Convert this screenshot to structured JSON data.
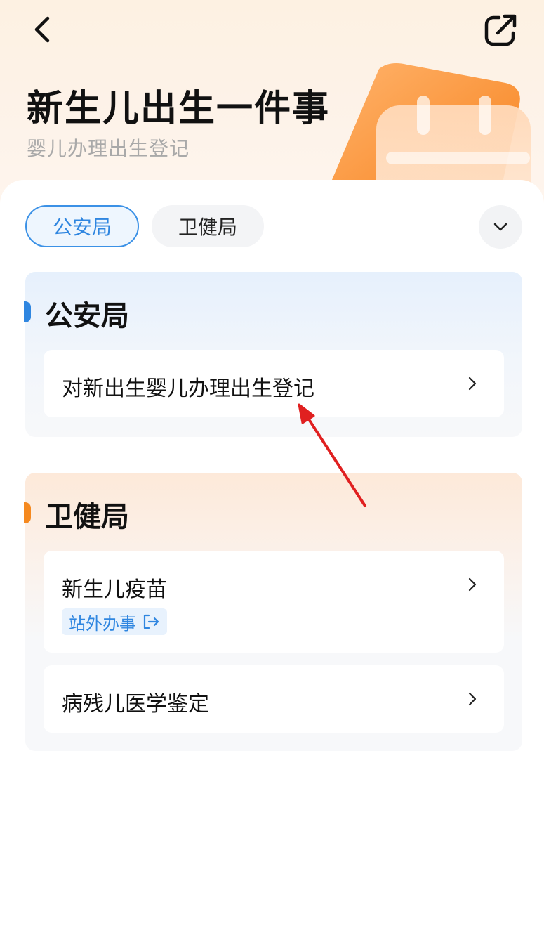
{
  "header": {
    "title": "新生儿出生一件事",
    "subtitle": "婴儿办理出生登记",
    "back_icon": "chevron-left-icon",
    "share_icon": "share-external-icon"
  },
  "tabs": [
    {
      "label": "公安局",
      "active": true
    },
    {
      "label": "卫健局",
      "active": false
    }
  ],
  "expand_icon": "chevron-down-icon",
  "sections": [
    {
      "title": "公安局",
      "accent": "#2f86e0",
      "items": [
        {
          "label": "对新出生婴儿办理出生登记"
        }
      ]
    },
    {
      "title": "卫健局",
      "accent": "#f5891f",
      "items": [
        {
          "label": "新生儿疫苗",
          "badge": "站外办事"
        },
        {
          "label": "病残儿医学鉴定"
        }
      ]
    }
  ],
  "colors": {
    "primary_blue": "#2f86e0",
    "accent_orange": "#f5891f",
    "annotation_red": "#e02020"
  }
}
